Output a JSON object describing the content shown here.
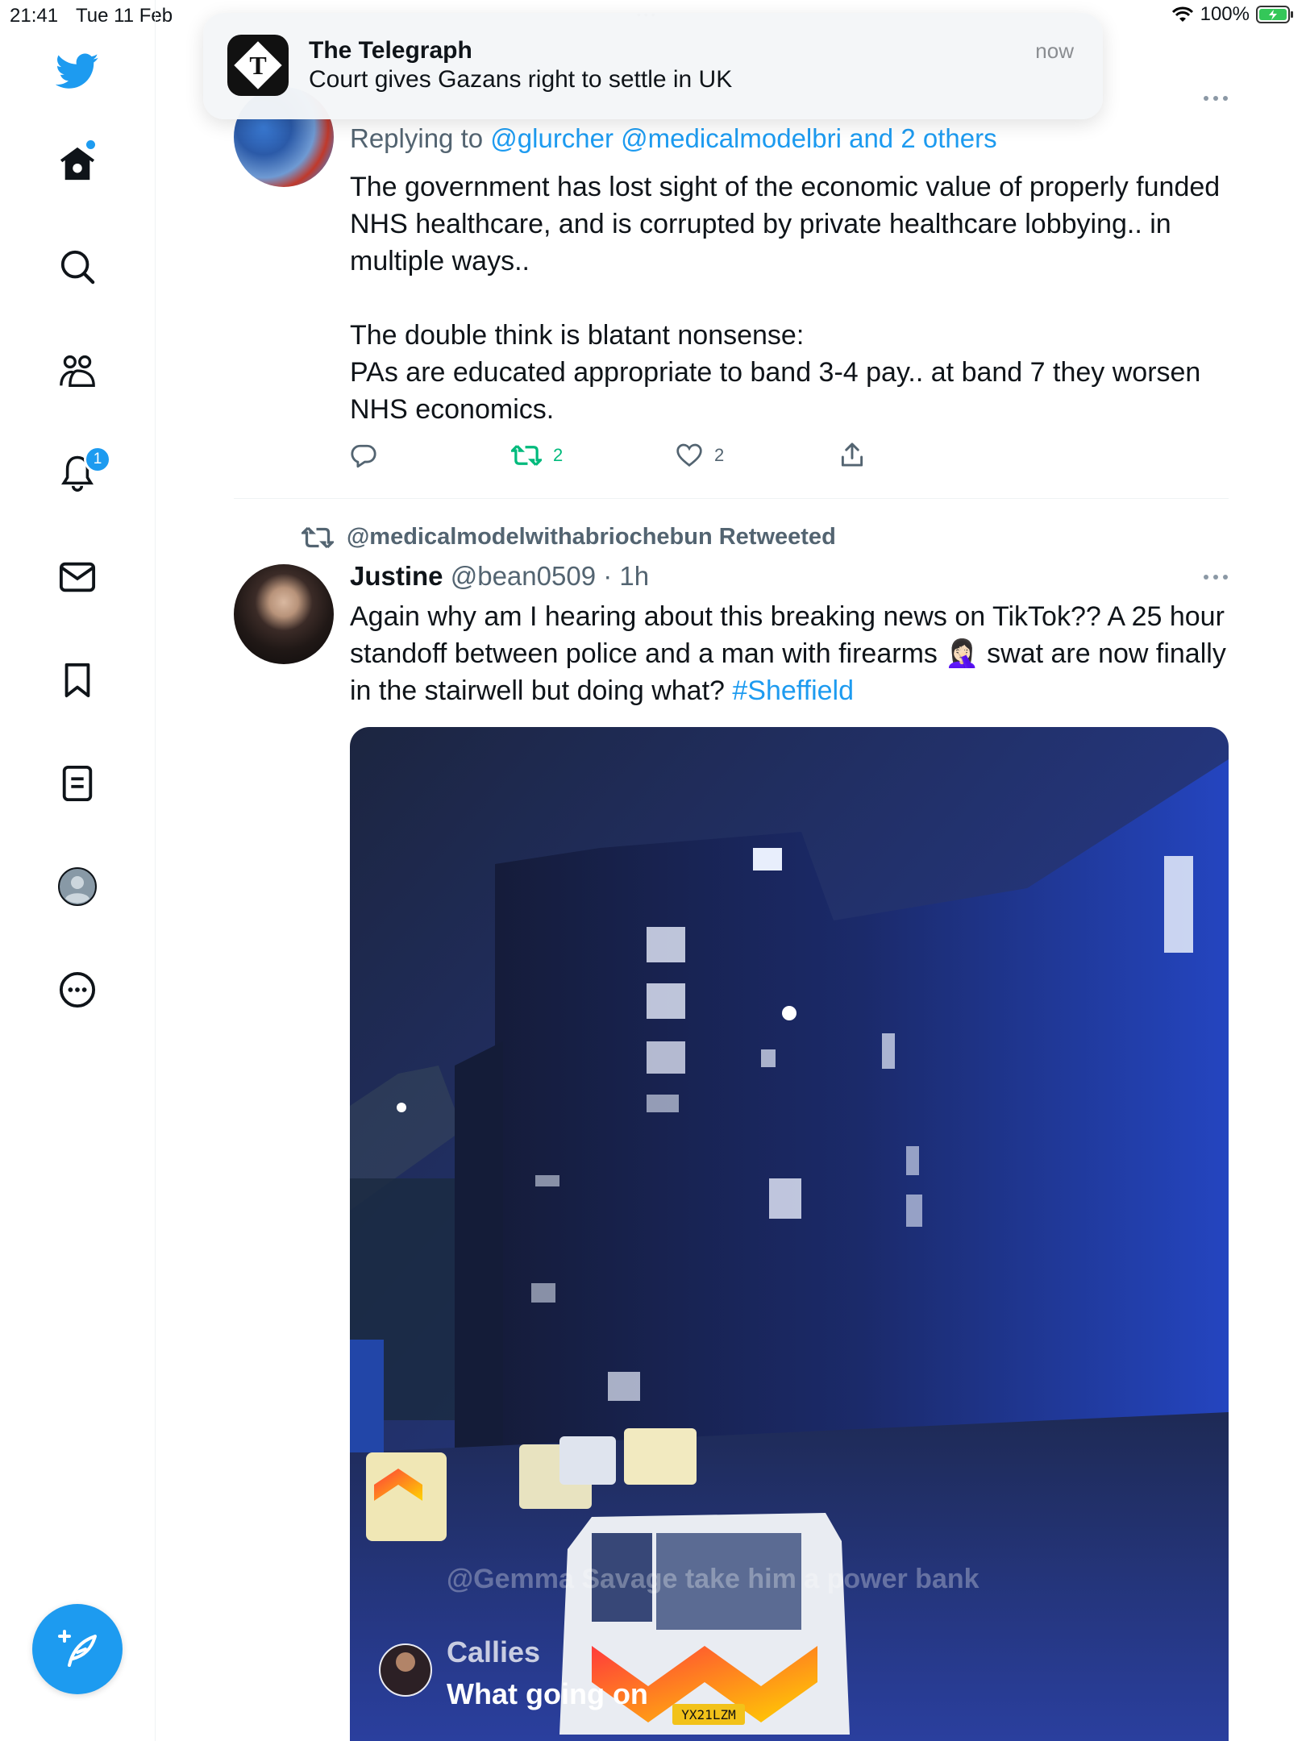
{
  "status_bar": {
    "time": "21:41",
    "date": "Tue 11 Feb",
    "battery": "100%"
  },
  "sidebar": {
    "items": [
      {
        "name": "home"
      },
      {
        "name": "explore"
      },
      {
        "name": "communities"
      },
      {
        "name": "notifications",
        "badge": "1"
      },
      {
        "name": "messages"
      },
      {
        "name": "bookmarks"
      },
      {
        "name": "lists"
      },
      {
        "name": "profile"
      },
      {
        "name": "more"
      }
    ]
  },
  "notification": {
    "app": "The Telegraph",
    "message": "Court gives Gazans right to settle in UK",
    "time": "now"
  },
  "reply_tweet": {
    "replying_prefix": "Replying to",
    "replying_to": "@glurcher @medicalmodelbri and 2 others",
    "text": "The government has lost sight of the economic value of properly funded NHS healthcare, and is corrupted by private healthcare lobbying.. in multiple ways..\n\nThe double think is blatant nonsense:\nPAs are educated appropriate to band 3-4 pay.. at band 7 they worsen NHS economics.",
    "retweets": "2",
    "likes": "2"
  },
  "retweet_tweet": {
    "retweeted_by": "@medicalmodelwithabriochebun Retweeted",
    "author_name": "Justine",
    "author_handle": "@bean0509",
    "time": "· 1h",
    "text_before": "Again why am I hearing about this breaking news on TikTok?? A 25 hour standoff between police and a man with firearms ",
    "emoji": "🤦🏻‍♀️",
    "text_after": " swat are now finally in the stairwell but doing what? ",
    "hashtag": "#Sheffield",
    "media_overlay": {
      "watermark": "@Gemma Savage take him a power bank",
      "caption_user": "Callies",
      "caption_text": "What going on",
      "plate": "YX21LZM"
    }
  },
  "colors": {
    "accent": "#1d9bf0",
    "retweet_green": "#00ba7c",
    "text_gray": "#536471"
  }
}
